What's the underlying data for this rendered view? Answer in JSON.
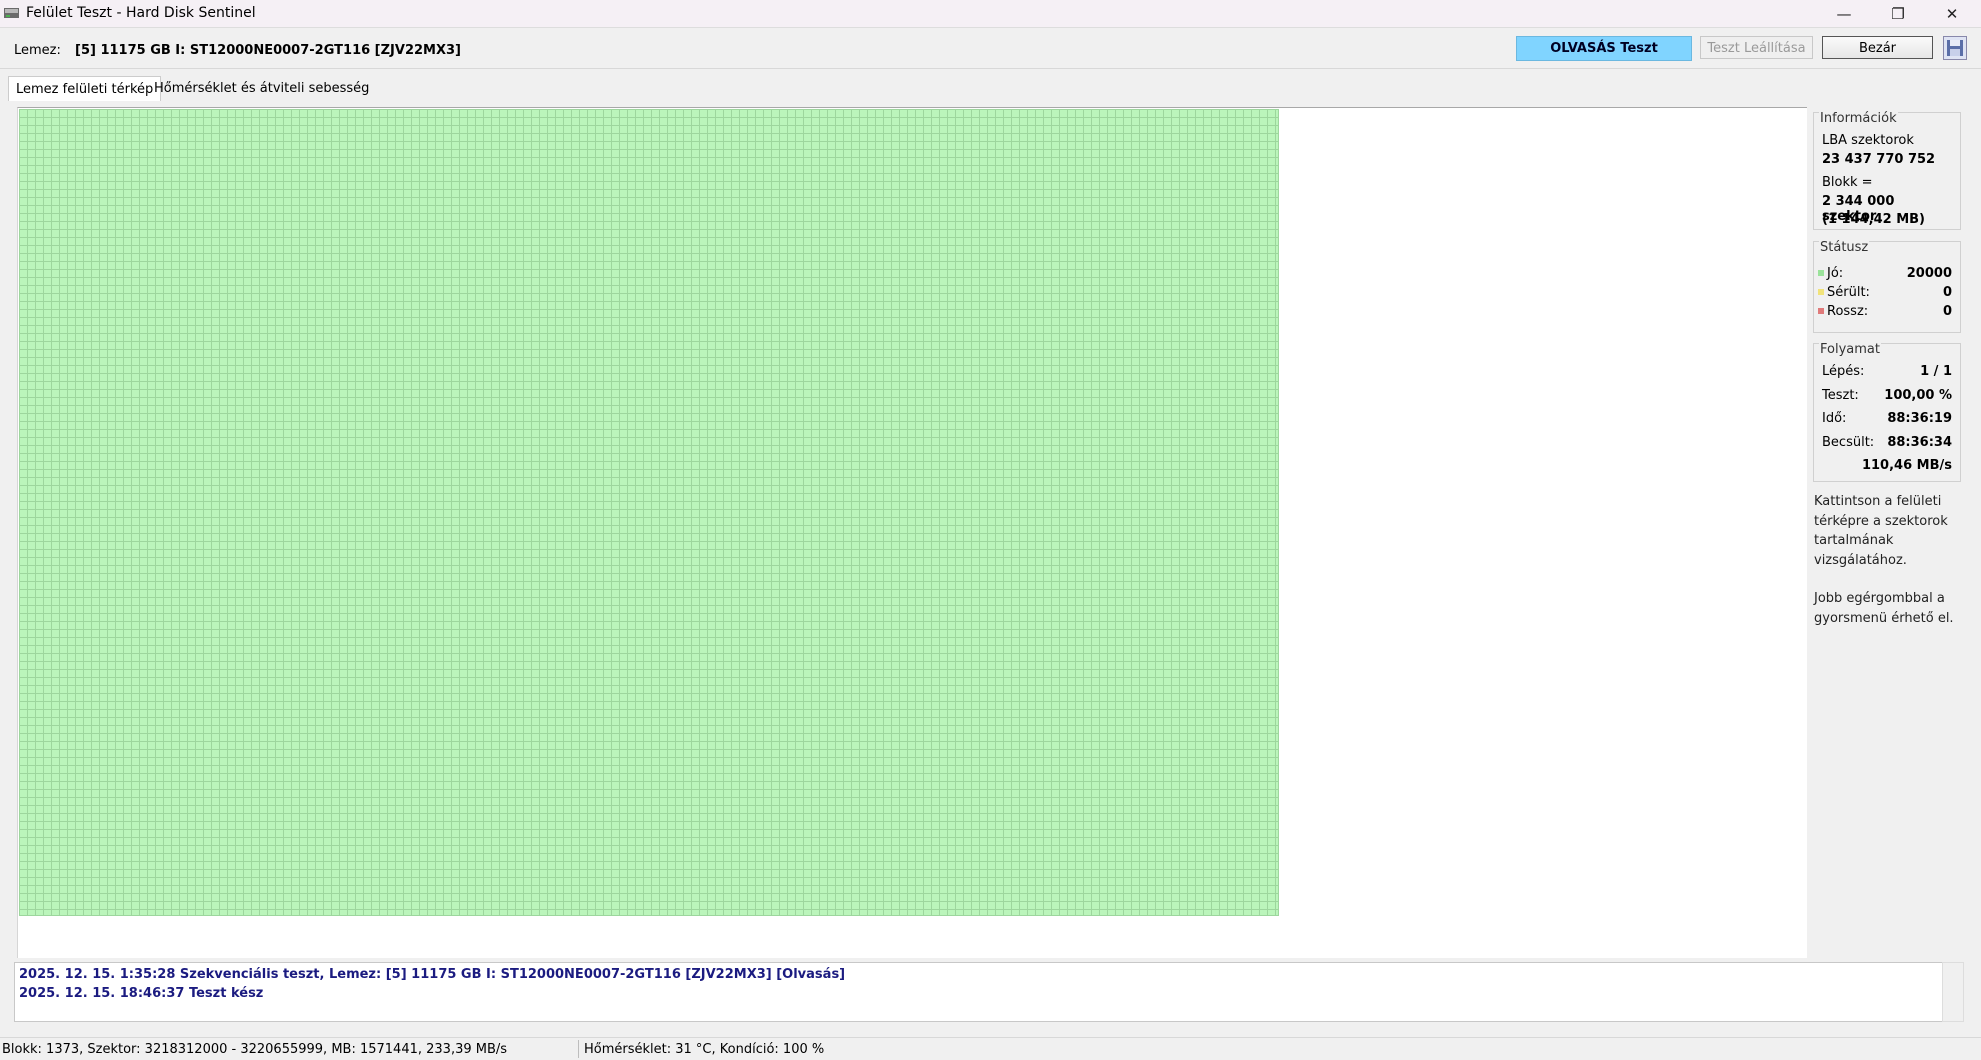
{
  "window": {
    "title": "Felület Teszt - Hard Disk Sentinel",
    "minimize_glyph": "—",
    "restore_glyph": "❐",
    "close_glyph": "✕"
  },
  "toolbar": {
    "disk_label": "Lemez:",
    "disk_value": "[5] 11175 GB I: ST12000NE0007-2GT116 [ZJV22MX3]",
    "mode": "OLVASÁS Teszt",
    "stop_label": "Teszt Leállítása",
    "close_label": "Bezár",
    "mode_color": "#80d4ff"
  },
  "tabs": [
    {
      "label": "Lemez felületi térkép"
    },
    {
      "label": "Hőmérséklet és átviteli sebesség"
    }
  ],
  "map": {
    "block_color": "#bbf5bb",
    "block_state": "good"
  },
  "info": {
    "title": "Információk",
    "lba_label": "LBA szektorok",
    "lba_value": "23 437 770 752",
    "block_label": "Blokk =",
    "block_value1": "2 344 000 szektor",
    "block_value2": "(1 144,42 MB)"
  },
  "status": {
    "title": "Státusz",
    "items": [
      {
        "label": "Jó:",
        "value": "20000",
        "color": "#9be39b"
      },
      {
        "label": "Sérült:",
        "value": "0",
        "color": "#f1e37a"
      },
      {
        "label": "Rossz:",
        "value": "0",
        "color": "#e07a7a"
      }
    ]
  },
  "progress": {
    "title": "Folyamat",
    "items": [
      {
        "label": "Lépés:",
        "value": "1 / 1"
      },
      {
        "label": "Teszt:",
        "value": "100,00 %"
      },
      {
        "label": "Idő:",
        "value": "88:36:19"
      },
      {
        "label": "Becsült:",
        "value": "88:36:34"
      }
    ],
    "speed": "110,46 MB/s"
  },
  "help": {
    "line1": "Kattintson a felületi",
    "line2": "térképre a szektorok",
    "line3": "tartalmának",
    "line4": "vizsgálatához.",
    "line5": "Jobb egérgombbal a",
    "line6": "gyorsmenü érhető el."
  },
  "log": [
    {
      "text": "2025. 12. 15.  1:35:28   Szekvenciális teszt, Lemez: [5] 11175 GB I: ST12000NE0007-2GT116 [ZJV22MX3] [Olvasás]"
    },
    {
      "text": "2025. 12. 15.  18:46:37   Teszt kész"
    }
  ],
  "statusbar": {
    "left": "Blokk: 1373, Szektor: 3218312000 - 3220655999, MB: 1571441, 233,39 MB/s",
    "right": "Hőmérséklet: 31  °C,  Kondíció: 100 %"
  }
}
